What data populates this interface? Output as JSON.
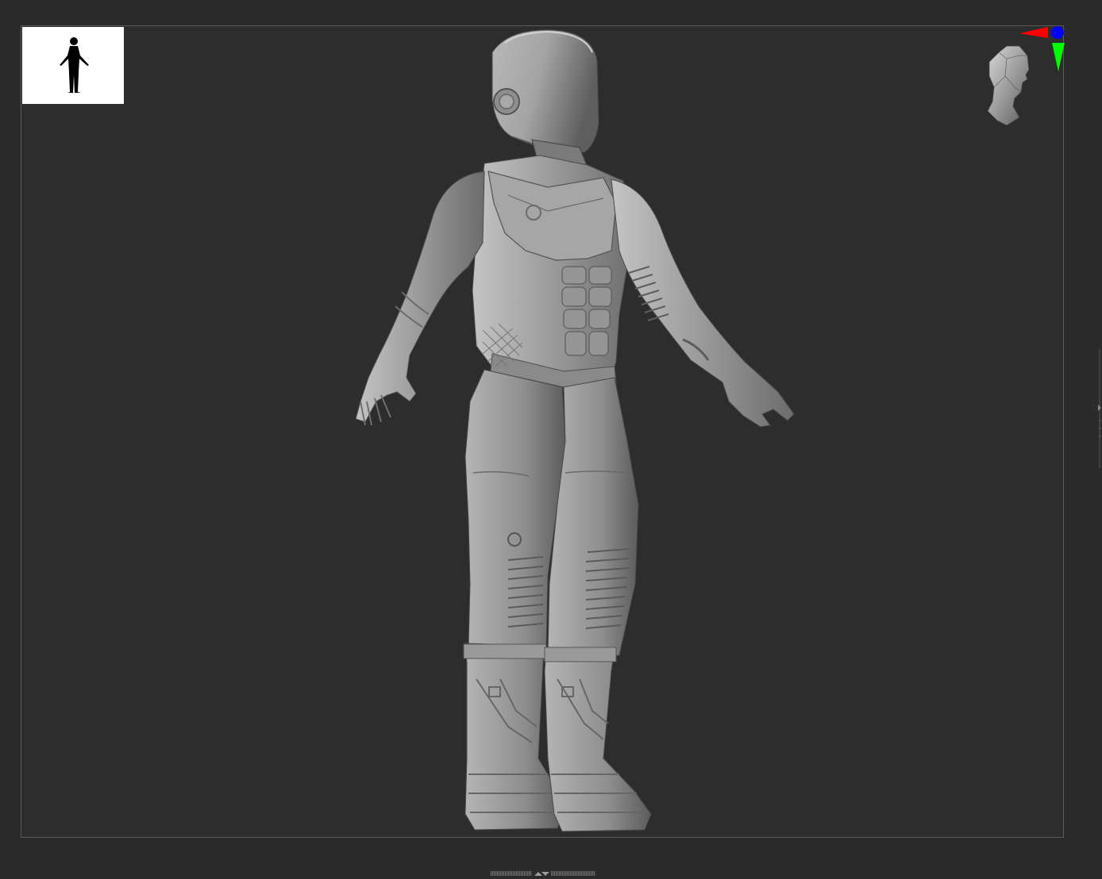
{
  "viewport": {
    "background": "#2d2d2d",
    "border_color": "#5a5a5a"
  },
  "navigator": {
    "icon": "human-silhouette-icon",
    "background": "#ffffff"
  },
  "gizmo": {
    "icon": "head-orientation-icon",
    "axes": {
      "x_color": "#ff0000",
      "y_color": "#00ff00",
      "z_color": "#0000ff"
    }
  },
  "model": {
    "icon": "spacesuit-sculpt-model",
    "color": "#9a9a9a"
  },
  "bottom_bar": {
    "icon": "tray-toggle-arrows-icon"
  }
}
